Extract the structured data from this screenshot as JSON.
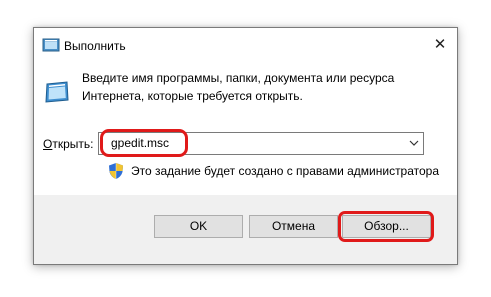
{
  "window": {
    "title": "Выполнить",
    "close_glyph": "✕",
    "icon": "run-icon"
  },
  "description": "Введите имя программы, папки, документа или ресурса Интернета, которые требуется открыть.",
  "open": {
    "label_accel": "О",
    "label_rest": "ткрыть:",
    "value": "gpedit.msc"
  },
  "admin_note": "Это задание будет создано с правами администратора",
  "buttons": {
    "ok": "OK",
    "cancel": "Отмена",
    "browse": "Обзор..."
  },
  "colors": {
    "highlight": "#e01a1a",
    "footer_bg": "#f0f0f0",
    "button_bg": "#e1e1e1"
  }
}
